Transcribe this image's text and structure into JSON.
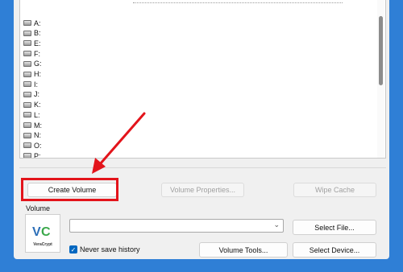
{
  "drives": [
    {
      "letter": "A:"
    },
    {
      "letter": "B:"
    },
    {
      "letter": "E:"
    },
    {
      "letter": "F:"
    },
    {
      "letter": "G:"
    },
    {
      "letter": "H:"
    },
    {
      "letter": "I:"
    },
    {
      "letter": "J:"
    },
    {
      "letter": "K:"
    },
    {
      "letter": "L:"
    },
    {
      "letter": "M:"
    },
    {
      "letter": "N:"
    },
    {
      "letter": "O:"
    },
    {
      "letter": "P:"
    }
  ],
  "buttons": {
    "create_volume": "Create Volume",
    "volume_properties": "Volume Properties...",
    "wipe_cache": "Wipe Cache",
    "select_file": "Select File...",
    "volume_tools": "Volume Tools...",
    "select_device": "Select Device..."
  },
  "volume": {
    "group_label": "Volume",
    "path_value": "",
    "never_save_history_label": "Never save history",
    "never_save_history_checked": true
  },
  "logo": {
    "text": "VeraCrypt"
  },
  "colors": {
    "background": "#2f7fd6",
    "annotation": "#e3141b",
    "checkbox": "#0067c0"
  }
}
